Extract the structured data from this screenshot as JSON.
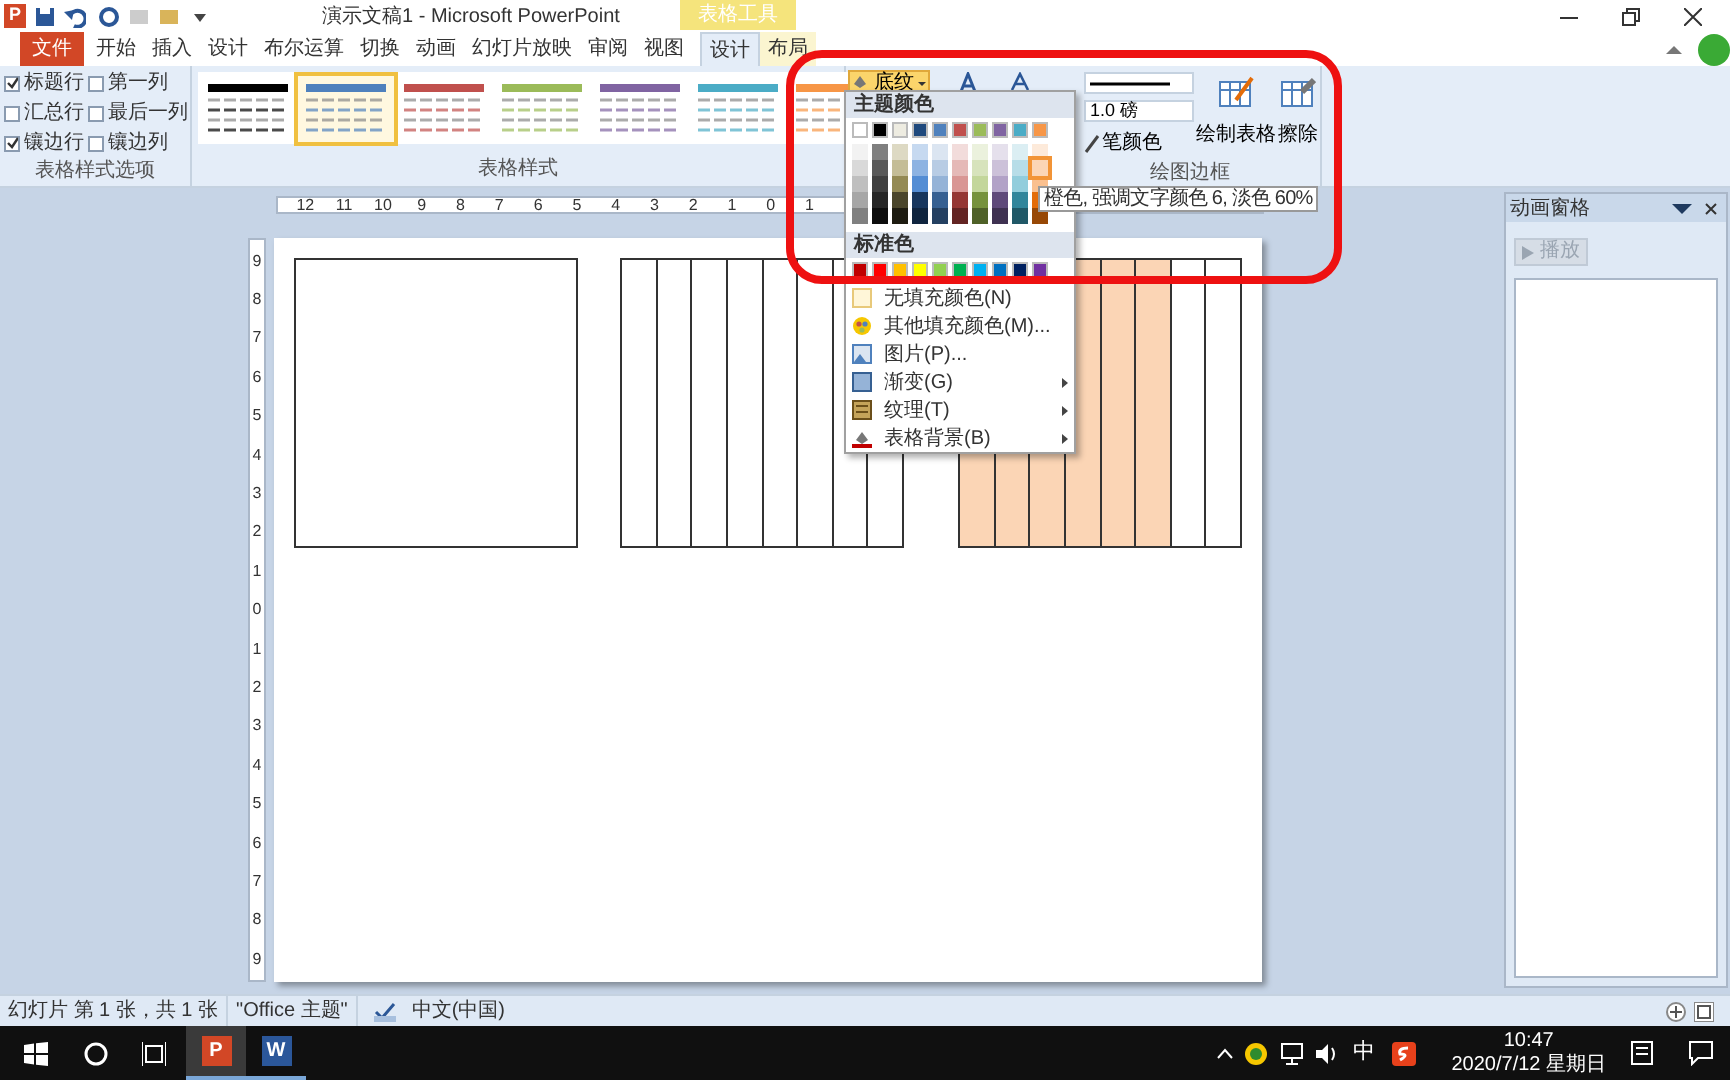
{
  "window": {
    "app_letter": "P",
    "title": "演示文稿1 - Microsoft PowerPoint",
    "context_group": "表格工具"
  },
  "tabs": [
    {
      "label": "文件",
      "kind": "file",
      "selected": false
    },
    {
      "label": "开始",
      "kind": "main",
      "selected": false
    },
    {
      "label": "插入",
      "kind": "main",
      "selected": false
    },
    {
      "label": "设计",
      "kind": "main",
      "selected": false
    },
    {
      "label": "布尔运算",
      "kind": "main",
      "selected": false
    },
    {
      "label": "切换",
      "kind": "main",
      "selected": false
    },
    {
      "label": "动画",
      "kind": "main",
      "selected": false
    },
    {
      "label": "幻灯片放映",
      "kind": "main",
      "selected": false
    },
    {
      "label": "审阅",
      "kind": "main",
      "selected": false
    },
    {
      "label": "视图",
      "kind": "main",
      "selected": false
    },
    {
      "label": "设计",
      "kind": "context",
      "selected": true
    },
    {
      "label": "布局",
      "kind": "context",
      "selected": false
    }
  ],
  "table_style_options": {
    "label": "表格样式选项",
    "options": [
      {
        "label": "标题行",
        "checked": true
      },
      {
        "label": "第一列",
        "checked": false
      },
      {
        "label": "汇总行",
        "checked": false
      },
      {
        "label": "最后一列",
        "checked": false
      },
      {
        "label": "镶边行",
        "checked": true
      },
      {
        "label": "镶边列",
        "checked": false
      }
    ]
  },
  "table_styles": {
    "label": "表格样式",
    "styles": [
      {
        "color": "#000000",
        "selected": false
      },
      {
        "color": "#4f81bd",
        "selected": true
      },
      {
        "color": "#c0504d",
        "selected": false
      },
      {
        "color": "#9bbb59",
        "selected": false
      },
      {
        "color": "#8064a2",
        "selected": false
      },
      {
        "color": "#4bacc6",
        "selected": false
      },
      {
        "color": "#f79646",
        "selected": false
      }
    ]
  },
  "draw_borders": {
    "label": "绘图边框",
    "shading": "底纹",
    "pen_weight": "1.0 磅",
    "pen_color": "笔颜色",
    "draw_table": "绘制表格",
    "eraser": "擦除"
  },
  "shading_menu": {
    "theme_header": "主题颜色",
    "theme_colors": [
      {
        "color": "#ffffff",
        "shades": [
          {
            "color": "#f2f2f2",
            "selected": false
          },
          {
            "color": "#d9d9d9",
            "selected": false
          },
          {
            "color": "#bfbfbf",
            "selected": false
          },
          {
            "color": "#a6a6a6",
            "selected": false
          },
          {
            "color": "#808080",
            "selected": false
          }
        ]
      },
      {
        "color": "#000000",
        "shades": [
          {
            "color": "#7f7f7f",
            "selected": false
          },
          {
            "color": "#595959",
            "selected": false
          },
          {
            "color": "#404040",
            "selected": false
          },
          {
            "color": "#262626",
            "selected": false
          },
          {
            "color": "#0d0d0d",
            "selected": false
          }
        ]
      },
      {
        "color": "#eeece1",
        "shades": [
          {
            "color": "#ddd9c3",
            "selected": false
          },
          {
            "color": "#c4bd97",
            "selected": false
          },
          {
            "color": "#948a54",
            "selected": false
          },
          {
            "color": "#4a452a",
            "selected": false
          },
          {
            "color": "#1d1b10",
            "selected": false
          }
        ]
      },
      {
        "color": "#1f497d",
        "shades": [
          {
            "color": "#c6d9f0",
            "selected": false
          },
          {
            "color": "#8db3e2",
            "selected": false
          },
          {
            "color": "#548dd4",
            "selected": false
          },
          {
            "color": "#17365d",
            "selected": false
          },
          {
            "color": "#0f243e",
            "selected": false
          }
        ]
      },
      {
        "color": "#4f81bd",
        "shades": [
          {
            "color": "#dbe5f1",
            "selected": false
          },
          {
            "color": "#b8cce4",
            "selected": false
          },
          {
            "color": "#95b3d7",
            "selected": false
          },
          {
            "color": "#366092",
            "selected": false
          },
          {
            "color": "#244061",
            "selected": false
          }
        ]
      },
      {
        "color": "#c0504d",
        "shades": [
          {
            "color": "#f2dcdb",
            "selected": false
          },
          {
            "color": "#e5b9b7",
            "selected": false
          },
          {
            "color": "#d99694",
            "selected": false
          },
          {
            "color": "#953734",
            "selected": false
          },
          {
            "color": "#632423",
            "selected": false
          }
        ]
      },
      {
        "color": "#9bbb59",
        "shades": [
          {
            "color": "#ebf1dd",
            "selected": false
          },
          {
            "color": "#d7e3bc",
            "selected": false
          },
          {
            "color": "#c3d69b",
            "selected": false
          },
          {
            "color": "#76923c",
            "selected": false
          },
          {
            "color": "#4f6128",
            "selected": false
          }
        ]
      },
      {
        "color": "#8064a2",
        "shades": [
          {
            "color": "#e5e0ec",
            "selected": false
          },
          {
            "color": "#ccc1d9",
            "selected": false
          },
          {
            "color": "#b2a2c7",
            "selected": false
          },
          {
            "color": "#5f497a",
            "selected": false
          },
          {
            "color": "#3f3151",
            "selected": false
          }
        ]
      },
      {
        "color": "#4bacc6",
        "shades": [
          {
            "color": "#dbeef3",
            "selected": false
          },
          {
            "color": "#b7dde8",
            "selected": false
          },
          {
            "color": "#92cddc",
            "selected": false
          },
          {
            "color": "#31859b",
            "selected": false
          },
          {
            "color": "#205867",
            "selected": false
          }
        ]
      },
      {
        "color": "#f79646",
        "shades": [
          {
            "color": "#fdeada",
            "selected": false
          },
          {
            "color": "#fbd5b5",
            "selected": true
          },
          {
            "color": "#fac08f",
            "selected": false
          },
          {
            "color": "#e36c09",
            "selected": false
          },
          {
            "color": "#974806",
            "selected": false
          }
        ]
      }
    ],
    "standard_header": "标准色",
    "standard_colors": [
      {
        "color": "#c00000"
      },
      {
        "color": "#ff0000"
      },
      {
        "color": "#ffc000"
      },
      {
        "color": "#ffff00"
      },
      {
        "color": "#92d050"
      },
      {
        "color": "#00b050"
      },
      {
        "color": "#00b0f0"
      },
      {
        "color": "#0070c0"
      },
      {
        "color": "#002060"
      },
      {
        "color": "#7030a0"
      }
    ],
    "items": [
      {
        "label": "无填充颜色(N)",
        "kind": "no-fill",
        "submenu": false
      },
      {
        "label": "其他填充颜色(M)...",
        "kind": "more-colors",
        "submenu": false
      },
      {
        "label": "图片(P)...",
        "kind": "picture",
        "submenu": false
      },
      {
        "label": "渐变(G)",
        "kind": "gradient",
        "submenu": true
      },
      {
        "label": "纹理(T)",
        "kind": "texture",
        "submenu": true
      },
      {
        "label": "表格背景(B)",
        "kind": "table-background",
        "submenu": true
      }
    ],
    "tooltip": "橙色, 强调文字颜色 6, 淡色 60%"
  },
  "rulers": {
    "horizontal": [
      "12",
      "11",
      "10",
      "9",
      "8",
      "7",
      "6",
      "5",
      "4",
      "3",
      "2",
      "1",
      "0",
      "1"
    ],
    "vertical": [
      "9",
      "8",
      "7",
      "6",
      "5",
      "4",
      "3",
      "2",
      "1",
      "0",
      "1",
      "2",
      "3",
      "4",
      "5",
      "6",
      "7",
      "8",
      "9"
    ]
  },
  "slide": {
    "tables": [
      {
        "cells": [
          {
            "filled": false
          }
        ]
      },
      {
        "cells": [
          {
            "filled": false
          },
          {
            "filled": false
          },
          {
            "filled": false
          },
          {
            "filled": false
          },
          {
            "filled": false
          },
          {
            "filled": false
          },
          {
            "filled": false
          },
          {
            "filled": false
          }
        ]
      },
      {
        "cells": [
          {
            "filled": true
          },
          {
            "filled": true
          },
          {
            "filled": true
          },
          {
            "filled": true
          },
          {
            "filled": true
          },
          {
            "filled": true
          },
          {
            "filled": false
          },
          {
            "filled": false
          }
        ]
      }
    ]
  },
  "animation_pane": {
    "title": "动画窗格",
    "play": "播放",
    "play_disabled": true
  },
  "status_bar": [
    "幻灯片 第 1 张，共 1 张",
    "\"Office 主题\"",
    "中文(中国)"
  ],
  "taskbar": {
    "apps": [
      {
        "letter": "P",
        "kind": "powerpoint",
        "selected": true
      },
      {
        "letter": "W",
        "kind": "word",
        "selected": false
      }
    ],
    "ime": "中",
    "time": "10:47",
    "date": "2020/7/12 星期日"
  }
}
